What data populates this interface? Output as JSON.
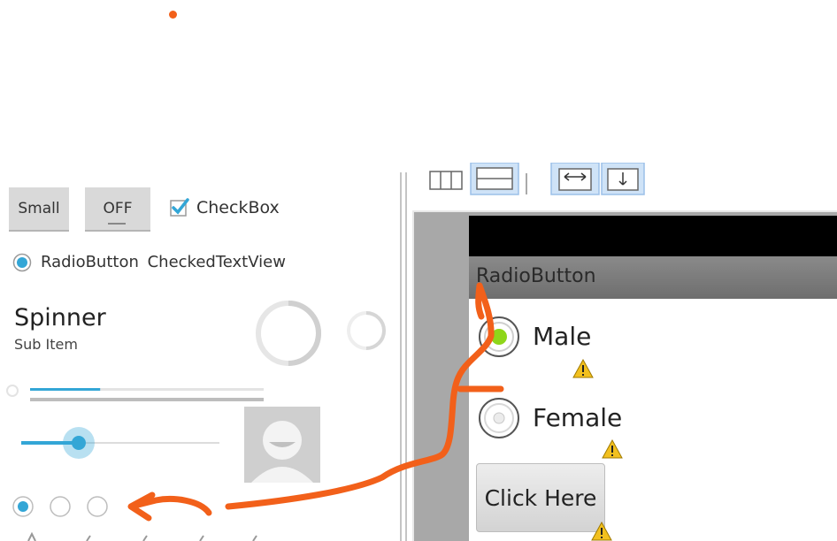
{
  "palette": {
    "small_button_label": "Small",
    "toggle_label": "OFF",
    "checkbox_label": "CheckBox",
    "radio_label": "RadioButton",
    "checked_text_label": "CheckedTextView",
    "spinner_title": "Spinner",
    "spinner_subtitle": "Sub Item",
    "checkbox_checked": true,
    "radio_checked": true,
    "progress_fraction": 0.3,
    "seek_fraction": 0.29
  },
  "toolbar": {
    "icons": [
      "table-layout-icon",
      "table-row-icon",
      "fit-width-icon",
      "fit-height-icon"
    ]
  },
  "preview": {
    "title": "RadioButton",
    "options": [
      {
        "label": "Male",
        "checked": true
      },
      {
        "label": "Female",
        "checked": false
      }
    ],
    "button_label": "Click Here"
  },
  "colors": {
    "accent_blue": "#33a6d6",
    "radio_green": "#8fd61a",
    "annotation_orange": "#f2601a",
    "warning_yellow": "#f2c01e"
  }
}
